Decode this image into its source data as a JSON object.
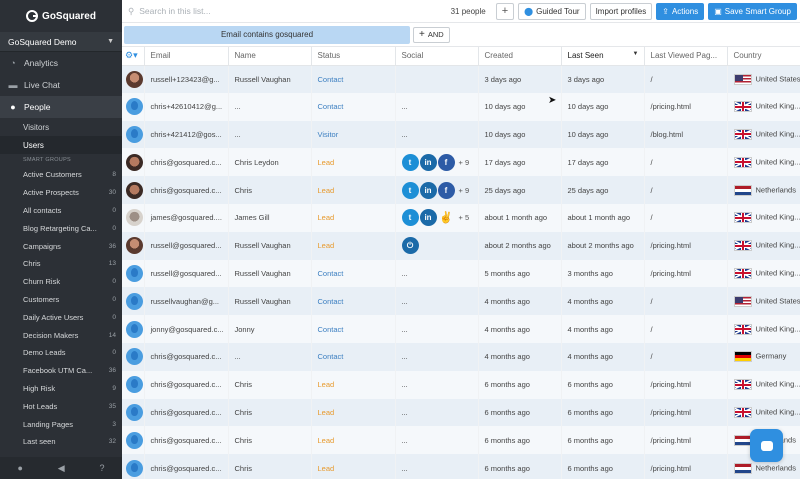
{
  "brand": {
    "name": "GoSquared"
  },
  "project": {
    "name": "GoSquared Demo"
  },
  "nav": {
    "analytics": "Analytics",
    "live_chat": "Live Chat",
    "people": "People",
    "visitors": "Visitors",
    "users": "Users",
    "smart_groups_header": "SMART GROUPS"
  },
  "smart_groups": [
    {
      "name": "Active Customers",
      "count": "8"
    },
    {
      "name": "Active Prospects",
      "count": "30"
    },
    {
      "name": "All contacts",
      "count": "0"
    },
    {
      "name": "Blog Retargeting Ca...",
      "count": "0"
    },
    {
      "name": "Campaigns",
      "count": "36"
    },
    {
      "name": "Chris",
      "count": "13"
    },
    {
      "name": "Churn Risk",
      "count": "0"
    },
    {
      "name": "Customers",
      "count": "0"
    },
    {
      "name": "Daily Active Users",
      "count": "0"
    },
    {
      "name": "Decision Makers",
      "count": "14"
    },
    {
      "name": "Demo Leads",
      "count": "0"
    },
    {
      "name": "Facebook UTM Ca...",
      "count": "36"
    },
    {
      "name": "High Risk",
      "count": "9"
    },
    {
      "name": "Hot Leads",
      "count": "35"
    },
    {
      "name": "Landing Pages",
      "count": "3"
    },
    {
      "name": "Last seen",
      "count": "32"
    }
  ],
  "toolbar": {
    "search_placeholder": "Search in this list...",
    "people_count": "31 people",
    "add_label": "+",
    "guided_tour": "Guided Tour",
    "import_profiles": "Import profiles",
    "actions": "Actions",
    "save_smart_group": "Save Smart Group"
  },
  "filter": {
    "chip": "Email contains gosquared",
    "and_label": "AND"
  },
  "columns": {
    "email": "Email",
    "name": "Name",
    "status": "Status",
    "social": "Social",
    "created": "Created",
    "last_seen": "Last Seen",
    "last_viewed": "Last Viewed Pag...",
    "country": "Country"
  },
  "rows": [
    {
      "avatar": "photo1",
      "email": "russell+123423@g...",
      "name": "Russell Vaughan",
      "status": "Contact",
      "social": [],
      "social_text": "",
      "created": "3 days ago",
      "last_seen": "3 days ago",
      "page": "/",
      "flag": "us",
      "country": "United States"
    },
    {
      "avatar": "blue",
      "email": "chris+42610412@g...",
      "name": "...",
      "status": "Contact",
      "social": [],
      "social_text": "...",
      "created": "10 days ago",
      "last_seen": "10 days ago",
      "page": "/pricing.html",
      "flag": "gb",
      "country": "United King..."
    },
    {
      "avatar": "blue",
      "email": "chris+421412@gos...",
      "name": "...",
      "status": "Visitor",
      "social": [],
      "social_text": "...",
      "created": "10 days ago",
      "last_seen": "10 days ago",
      "page": "/blog.html",
      "flag": "gb",
      "country": "United King..."
    },
    {
      "avatar": "photo2",
      "email": "chris@gosquared.c...",
      "name": "Chris Leydon",
      "status": "Lead",
      "social": [
        "tw",
        "li",
        "fb"
      ],
      "social_text": "",
      "social_more": "+ 9",
      "created": "17 days ago",
      "last_seen": "17 days ago",
      "page": "/",
      "flag": "gb",
      "country": "United King..."
    },
    {
      "avatar": "photo2",
      "email": "chris@gosquared.c...",
      "name": "Chris",
      "status": "Lead",
      "social": [
        "tw",
        "li",
        "fb"
      ],
      "social_text": "",
      "social_more": "+ 9",
      "created": "25 days ago",
      "last_seen": "25 days ago",
      "page": "/",
      "flag": "nl",
      "country": "Netherlands"
    },
    {
      "avatar": "photo3",
      "email": "james@gosquared....",
      "name": "James Gill",
      "status": "Lead",
      "social": [
        "tw",
        "li",
        "ag"
      ],
      "social_text": "",
      "social_more": "+ 5",
      "created": "about 1 month ago",
      "last_seen": "about 1 month ago",
      "page": "/",
      "flag": "gb",
      "country": "United King..."
    },
    {
      "avatar": "photo1",
      "email": "russell@gosquared...",
      "name": "Russell Vaughan",
      "status": "Lead",
      "social": [
        "pw"
      ],
      "social_text": "",
      "created": "about 2 months ago",
      "last_seen": "about 2 months ago",
      "page": "/pricing.html",
      "flag": "gb",
      "country": "United King..."
    },
    {
      "avatar": "blue",
      "email": "russell@gosquared...",
      "name": "Russell Vaughan",
      "status": "Contact",
      "social": [],
      "social_text": "...",
      "created": "5 months ago",
      "last_seen": "3 months ago",
      "page": "/pricing.html",
      "flag": "gb",
      "country": "United King..."
    },
    {
      "avatar": "blue",
      "email": "russellvaughan@g...",
      "name": "Russell Vaughan",
      "status": "Contact",
      "social": [],
      "social_text": "...",
      "created": "4 months ago",
      "last_seen": "4 months ago",
      "page": "/",
      "flag": "us",
      "country": "United States"
    },
    {
      "avatar": "blue",
      "email": "jonny@gosquared.c...",
      "name": "Jonny",
      "status": "Contact",
      "social": [],
      "social_text": "...",
      "created": "4 months ago",
      "last_seen": "4 months ago",
      "page": "/",
      "flag": "gb",
      "country": "United King..."
    },
    {
      "avatar": "blue",
      "email": "chris@gosquared.c...",
      "name": "...",
      "status": "Contact",
      "social": [],
      "social_text": "...",
      "created": "4 months ago",
      "last_seen": "4 months ago",
      "page": "/",
      "flag": "de",
      "country": "Germany"
    },
    {
      "avatar": "blue",
      "email": "chris@gosquared.c...",
      "name": "Chris",
      "status": "Lead",
      "social": [],
      "social_text": "...",
      "created": "6 months ago",
      "last_seen": "6 months ago",
      "page": "/pricing.html",
      "flag": "gb",
      "country": "United King..."
    },
    {
      "avatar": "blue",
      "email": "chris@gosquared.c...",
      "name": "Chris",
      "status": "Lead",
      "social": [],
      "social_text": "...",
      "created": "6 months ago",
      "last_seen": "6 months ago",
      "page": "/pricing.html",
      "flag": "gb",
      "country": "United King..."
    },
    {
      "avatar": "blue",
      "email": "chris@gosquared.c...",
      "name": "Chris",
      "status": "Lead",
      "social": [],
      "social_text": "...",
      "created": "6 months ago",
      "last_seen": "6 months ago",
      "page": "/pricing.html",
      "flag": "nl",
      "country": "Netherlands"
    },
    {
      "avatar": "blue",
      "email": "chris@gosquared.c...",
      "name": "Chris",
      "status": "Lead",
      "social": [],
      "social_text": "...",
      "created": "6 months ago",
      "last_seen": "6 months ago",
      "page": "/pricing.html",
      "flag": "nl",
      "country": "Netherlands"
    }
  ],
  "colors": {
    "sidebar_bg": "#2c3036",
    "accent": "#2f8fe0",
    "lead": "#e79a2d",
    "contact": "#3c7fc1"
  }
}
